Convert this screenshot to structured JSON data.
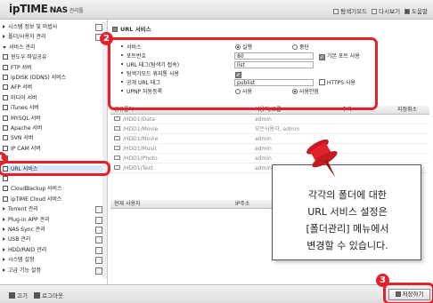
{
  "header": {
    "logo_main": "ipTIME",
    "logo_nas": "NAS",
    "logo_mgr": "관리툴",
    "links": [
      "탐색기모드",
      "다시보기",
      "도움말"
    ]
  },
  "sidebar": {
    "items": [
      {
        "label": "시스템 정보 및 마법사",
        "kind": "arrow"
      },
      {
        "label": "폴더/사용자 관리",
        "kind": "arrow"
      },
      {
        "label": "서비스 관리",
        "kind": "down"
      },
      {
        "label": "윈도우 파일공유",
        "kind": "box"
      },
      {
        "label": "FTP 서버",
        "kind": "box"
      },
      {
        "label": "ipDISK (DDNS) 서비스",
        "kind": "box"
      },
      {
        "label": "AFP 서버",
        "kind": "box"
      },
      {
        "label": "미디어 서버",
        "kind": "box"
      },
      {
        "label": "iTunes 서버",
        "kind": "box"
      },
      {
        "label": "MYSQL 서버",
        "kind": "box"
      },
      {
        "label": "Apache 서버",
        "kind": "box"
      },
      {
        "label": "SVN 서버",
        "kind": "box"
      },
      {
        "label": "IP CAM 서버",
        "kind": "box"
      },
      {
        "label": "",
        "kind": "box"
      },
      {
        "label": "URL 서비스",
        "kind": "box"
      },
      {
        "label": "",
        "kind": "box"
      },
      {
        "label": "CloudBackup 서비스",
        "kind": "box"
      },
      {
        "label": "ipTIME Cloud 서비스",
        "kind": "box"
      },
      {
        "label": "Torrent 관리",
        "kind": "arrow"
      },
      {
        "label": "Plug-in APP 관리",
        "kind": "arrow"
      },
      {
        "label": "NAS Sync 관리",
        "kind": "arrow"
      },
      {
        "label": "USB 관리",
        "kind": "arrow"
      },
      {
        "label": "HDD/RAID 관리",
        "kind": "arrow"
      },
      {
        "label": "시스템 설정",
        "kind": "arrow"
      },
      {
        "label": "고급 기능 설정",
        "kind": "arrow"
      }
    ],
    "selected_index": 14
  },
  "footer": {
    "links": [
      "끄기",
      "로그아웃"
    ]
  },
  "main": {
    "title": "URL 서비스",
    "form": {
      "service_label": "서비스",
      "service_on": "실행",
      "service_off": "중단",
      "port_label": "포트번호",
      "port_value": "80",
      "default_port_label": "기본 포트 사용",
      "tag_label": "URL 태그(탐색기 접속)",
      "tag_value": "list",
      "explorer_label": "탐색기모드 휴지통 사용",
      "public_tag_label": "공개 URL 태그",
      "public_tag_value": "publist",
      "https_label": "HTTPS 사용",
      "upnp_label": "UPNP 자동등록",
      "upnp_use": "사용",
      "upnp_nouse": "사용안함"
    },
    "folder_table": {
      "headers": [
        "공유폴더",
        "사용자/그룹",
        "추가",
        "지정취소"
      ],
      "rows": [
        {
          "path": "/HDD1/Data",
          "user": "admin"
        },
        {
          "path": "/HDD1/Movie",
          "user": "모든사용자, admin"
        },
        {
          "path": "/HDD1/Movie",
          "user": "admin"
        },
        {
          "path": "/HDD1/Music",
          "user": "admin"
        },
        {
          "path": "/HDD1/Photo",
          "user": "admin"
        },
        {
          "path": "/HDD1/Text",
          "user": "admin"
        }
      ]
    },
    "user_table": {
      "headers": [
        "현재 사용자",
        "IP주소"
      ]
    },
    "save_label": "저장하기"
  },
  "callout": {
    "text": "각각의 폴더에 대한\nURL 서비스 설정은\n[폴더관리] 메뉴에서\n변경할 수 있습니다."
  },
  "annotations": {
    "badges": [
      "1",
      "2",
      "3"
    ],
    "color": "#e4212a",
    "pin_color": "#e4212a"
  }
}
